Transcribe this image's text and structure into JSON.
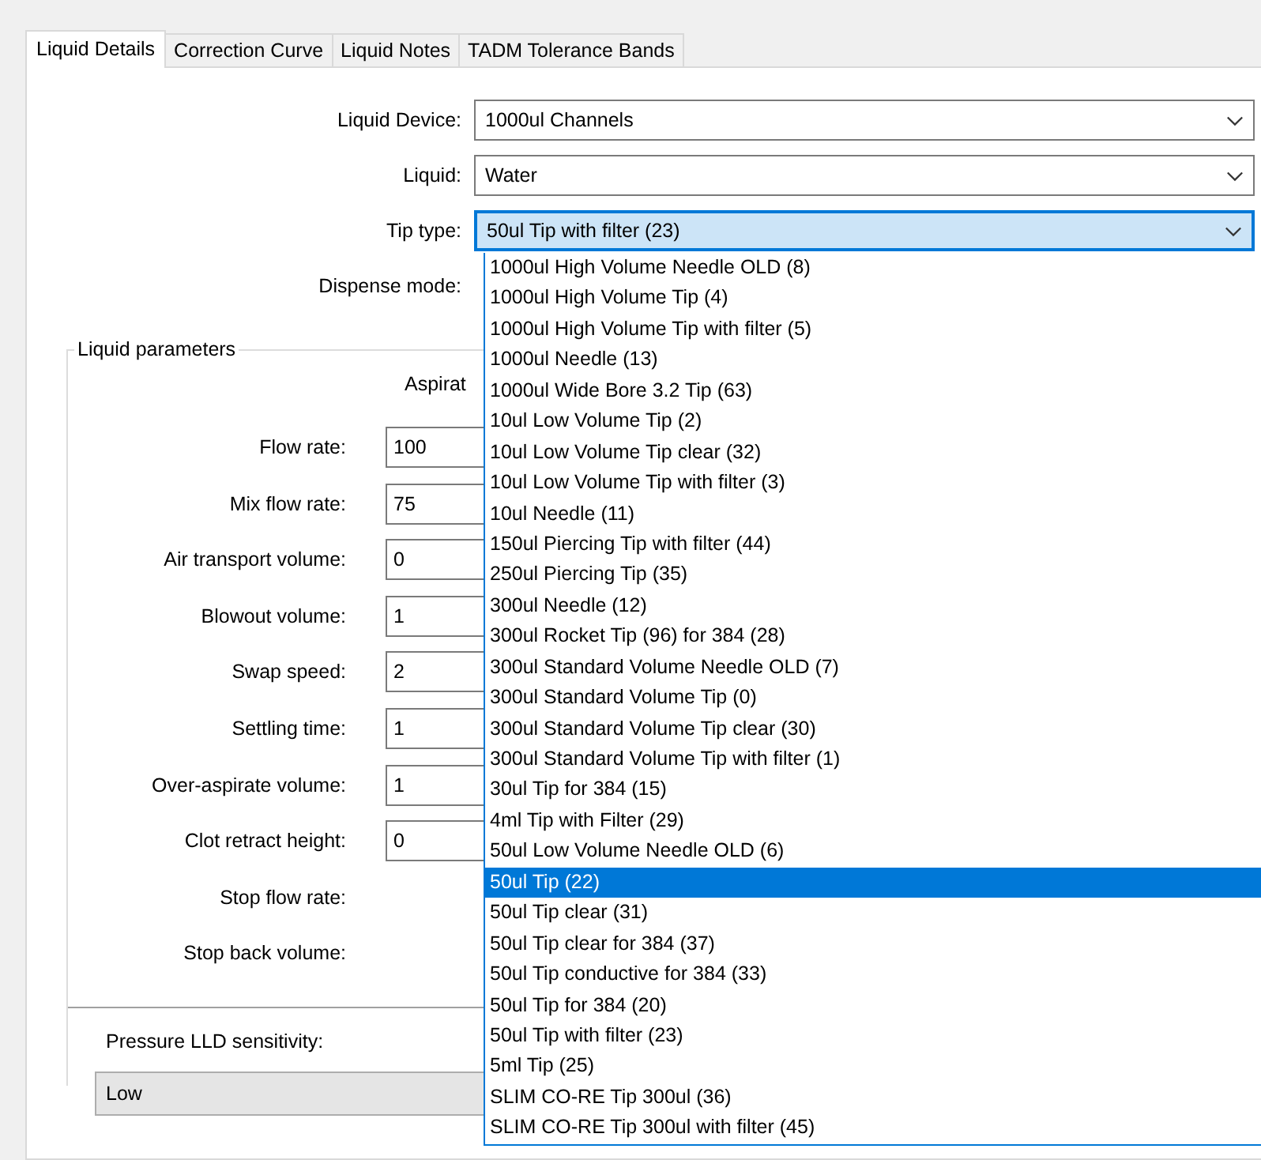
{
  "tabs": [
    {
      "label": "Liquid Details",
      "selected": true
    },
    {
      "label": "Correction Curve",
      "selected": false
    },
    {
      "label": "Liquid Notes",
      "selected": false
    },
    {
      "label": "TADM Tolerance Bands",
      "selected": false
    }
  ],
  "combos": [
    {
      "label": "Liquid Device:",
      "value": "1000ul Channels",
      "expanded": false,
      "kind": "combo"
    },
    {
      "label": "Liquid:",
      "value": "Water",
      "expanded": false,
      "kind": "combo"
    },
    {
      "label": "Tip type:",
      "value": "50ul Tip with filter (23)",
      "expanded": true,
      "kind": "combo"
    },
    {
      "label": "Dispense mode:",
      "kind": "label"
    }
  ],
  "dropdown": [
    {
      "label": "1000ul High Volume Needle OLD (8)",
      "selected": false
    },
    {
      "label": "1000ul High Volume Tip (4)",
      "selected": false
    },
    {
      "label": "1000ul High Volume Tip with filter (5)",
      "selected": false
    },
    {
      "label": "1000ul Needle (13)",
      "selected": false
    },
    {
      "label": "1000ul Wide Bore 3.2 Tip (63)",
      "selected": false
    },
    {
      "label": "10ul Low Volume Tip (2)",
      "selected": false
    },
    {
      "label": "10ul Low Volume Tip clear (32)",
      "selected": false
    },
    {
      "label": "10ul Low Volume Tip with filter (3)",
      "selected": false
    },
    {
      "label": "10ul Needle (11)",
      "selected": false
    },
    {
      "label": "150ul Piercing Tip with filter (44)",
      "selected": false
    },
    {
      "label": "250ul Piercing Tip (35)",
      "selected": false
    },
    {
      "label": "300ul Needle (12)",
      "selected": false
    },
    {
      "label": "300ul Rocket Tip (96) for 384 (28)",
      "selected": false
    },
    {
      "label": "300ul Standard Volume Needle OLD (7)",
      "selected": false
    },
    {
      "label": "300ul Standard Volume Tip (0)",
      "selected": false
    },
    {
      "label": "300ul Standard Volume Tip clear (30)",
      "selected": false
    },
    {
      "label": "300ul Standard Volume Tip with filter (1)",
      "selected": false
    },
    {
      "label": "30ul Tip for 384 (15)",
      "selected": false
    },
    {
      "label": "4ml Tip with Filter (29)",
      "selected": false
    },
    {
      "label": "50ul Low Volume Needle OLD (6)",
      "selected": false
    },
    {
      "label": "50ul Tip (22)",
      "selected": true
    },
    {
      "label": "50ul Tip clear (31)",
      "selected": false
    },
    {
      "label": "50ul Tip clear for 384 (37)",
      "selected": false
    },
    {
      "label": "50ul Tip conductive for 384 (33)",
      "selected": false
    },
    {
      "label": "50ul Tip for 384 (20)",
      "selected": false
    },
    {
      "label": "50ul Tip with filter (23)",
      "selected": false
    },
    {
      "label": "5ml Tip (25)",
      "selected": false
    },
    {
      "label": "SLIM CO-RE Tip 300ul (36)",
      "selected": false
    },
    {
      "label": "SLIM CO-RE Tip 300ul with filter (45)",
      "selected": false
    }
  ],
  "liquid_parameters": {
    "title": "Liquid parameters",
    "column_header": "Aspirat",
    "fields": [
      {
        "label": "Flow rate:",
        "value": "100",
        "kind": "input"
      },
      {
        "label": "Mix flow rate:",
        "value": "75",
        "kind": "input"
      },
      {
        "label": "Air transport volume:",
        "value": "0",
        "kind": "input"
      },
      {
        "label": "Blowout volume:",
        "value": "1",
        "kind": "input"
      },
      {
        "label": "Swap speed:",
        "value": "2",
        "kind": "input"
      },
      {
        "label": "Settling time:",
        "value": "1",
        "kind": "input"
      },
      {
        "label": "Over-aspirate volume:",
        "value": "1",
        "kind": "input"
      },
      {
        "label": "Clot retract height:",
        "value": "0",
        "kind": "input"
      },
      {
        "label": "Stop flow rate:",
        "kind": "label"
      },
      {
        "label": "Stop back volume:",
        "kind": "label"
      }
    ],
    "pressure_lld": {
      "label": "Pressure LLD sensitivity:",
      "value": "Low"
    }
  }
}
